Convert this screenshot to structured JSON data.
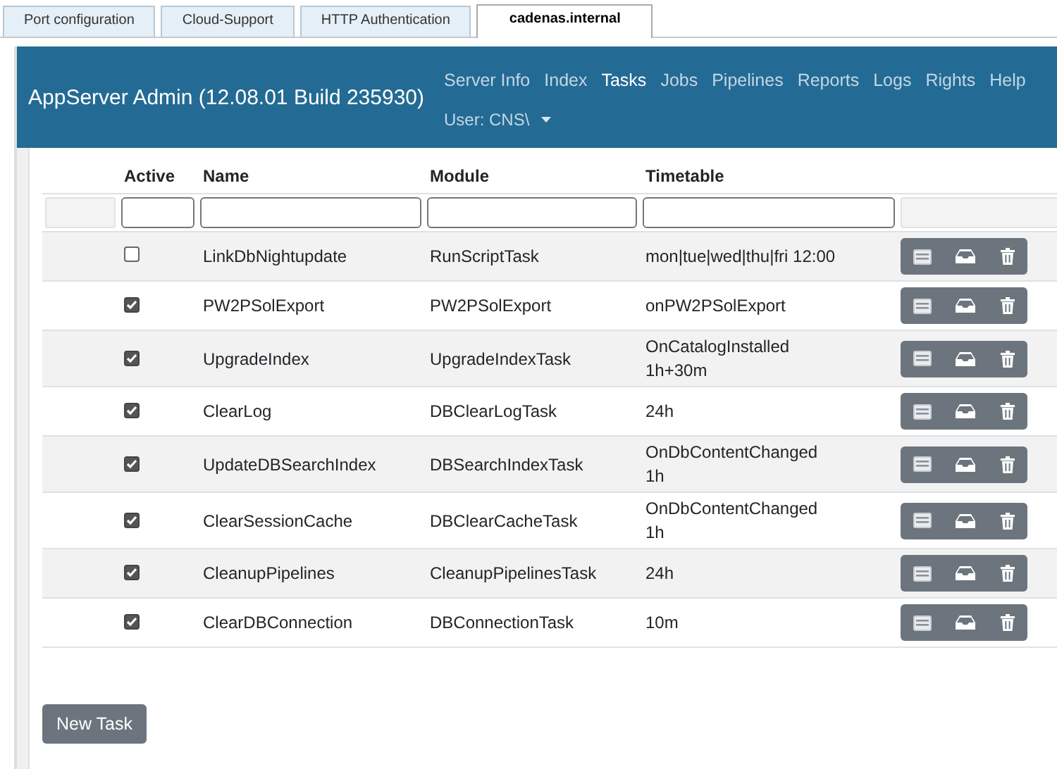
{
  "browser_tabs": [
    {
      "label": "Port configuration",
      "selected": false
    },
    {
      "label": "Cloud-Support",
      "selected": false
    },
    {
      "label": "HTTP Authentication",
      "selected": false
    },
    {
      "label": "cadenas.internal",
      "selected": true
    }
  ],
  "header": {
    "title": "AppServer Admin (12.08.01 Build 235930)",
    "nav": [
      {
        "label": "Server Info",
        "selected": false
      },
      {
        "label": "Index",
        "selected": false
      },
      {
        "label": "Tasks",
        "selected": true
      },
      {
        "label": "Jobs",
        "selected": false
      },
      {
        "label": "Pipelines",
        "selected": false
      },
      {
        "label": "Reports",
        "selected": false
      },
      {
        "label": "Logs",
        "selected": false
      },
      {
        "label": "Rights",
        "selected": false
      },
      {
        "label": "Help",
        "selected": false
      }
    ],
    "user": "User: CNS\\"
  },
  "table": {
    "columns": [
      "Active",
      "Name",
      "Module",
      "Timetable"
    ],
    "rows": [
      {
        "active": false,
        "name": "LinkDbNightupdate",
        "module": "RunScriptTask",
        "timetable": [
          "mon|tue|wed|thu|fri 12:00"
        ]
      },
      {
        "active": true,
        "name": "PW2PSolExport",
        "module": "PW2PSolExport",
        "timetable": [
          "onPW2PSolExport"
        ]
      },
      {
        "active": true,
        "name": "UpgradeIndex",
        "module": "UpgradeIndexTask",
        "timetable": [
          "OnCatalogInstalled",
          "1h+30m"
        ]
      },
      {
        "active": true,
        "name": "ClearLog",
        "module": "DBClearLogTask",
        "timetable": [
          "24h"
        ]
      },
      {
        "active": true,
        "name": "UpdateDBSearchIndex",
        "module": "DBSearchIndexTask",
        "timetable": [
          "OnDbContentChanged",
          "1h"
        ]
      },
      {
        "active": true,
        "name": "ClearSessionCache",
        "module": "DBClearCacheTask",
        "timetable": [
          "OnDbContentChanged",
          "1h"
        ]
      },
      {
        "active": true,
        "name": "CleanupPipelines",
        "module": "CleanupPipelinesTask",
        "timetable": [
          "24h"
        ]
      },
      {
        "active": true,
        "name": "ClearDBConnection",
        "module": "DBConnectionTask",
        "timetable": [
          "10m"
        ]
      }
    ]
  },
  "new_task_button": "New Task"
}
